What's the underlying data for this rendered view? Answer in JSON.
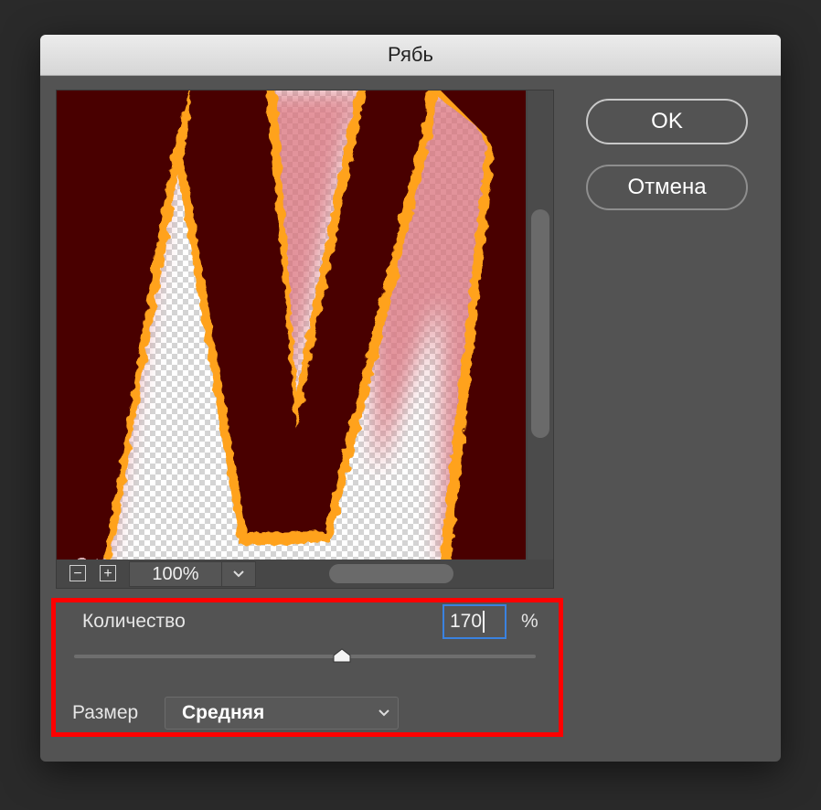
{
  "dialog": {
    "title": "Рябь"
  },
  "buttons": {
    "ok_label": "OK",
    "cancel_label": "Отмена"
  },
  "preview": {
    "zoom_value": "100%",
    "zoom_out_symbol": "−",
    "zoom_in_symbol": "+"
  },
  "amount": {
    "label": "Количество",
    "value": "170",
    "unit": "%",
    "slider_fraction": 0.58
  },
  "size": {
    "label": "Размер",
    "selected": "Средняя"
  },
  "colors": {
    "highlight_border": "#ff0000",
    "input_focus": "#3a82e0",
    "letter_fill": "#480000",
    "letter_glow": "#ffae00"
  },
  "icons": {
    "zoom_out": "minus-icon",
    "zoom_in": "plus-icon",
    "zoom_dropdown": "chevron-down-icon",
    "select_dropdown": "chevron-down-icon",
    "slider_handle": "slider-thumb-icon"
  }
}
